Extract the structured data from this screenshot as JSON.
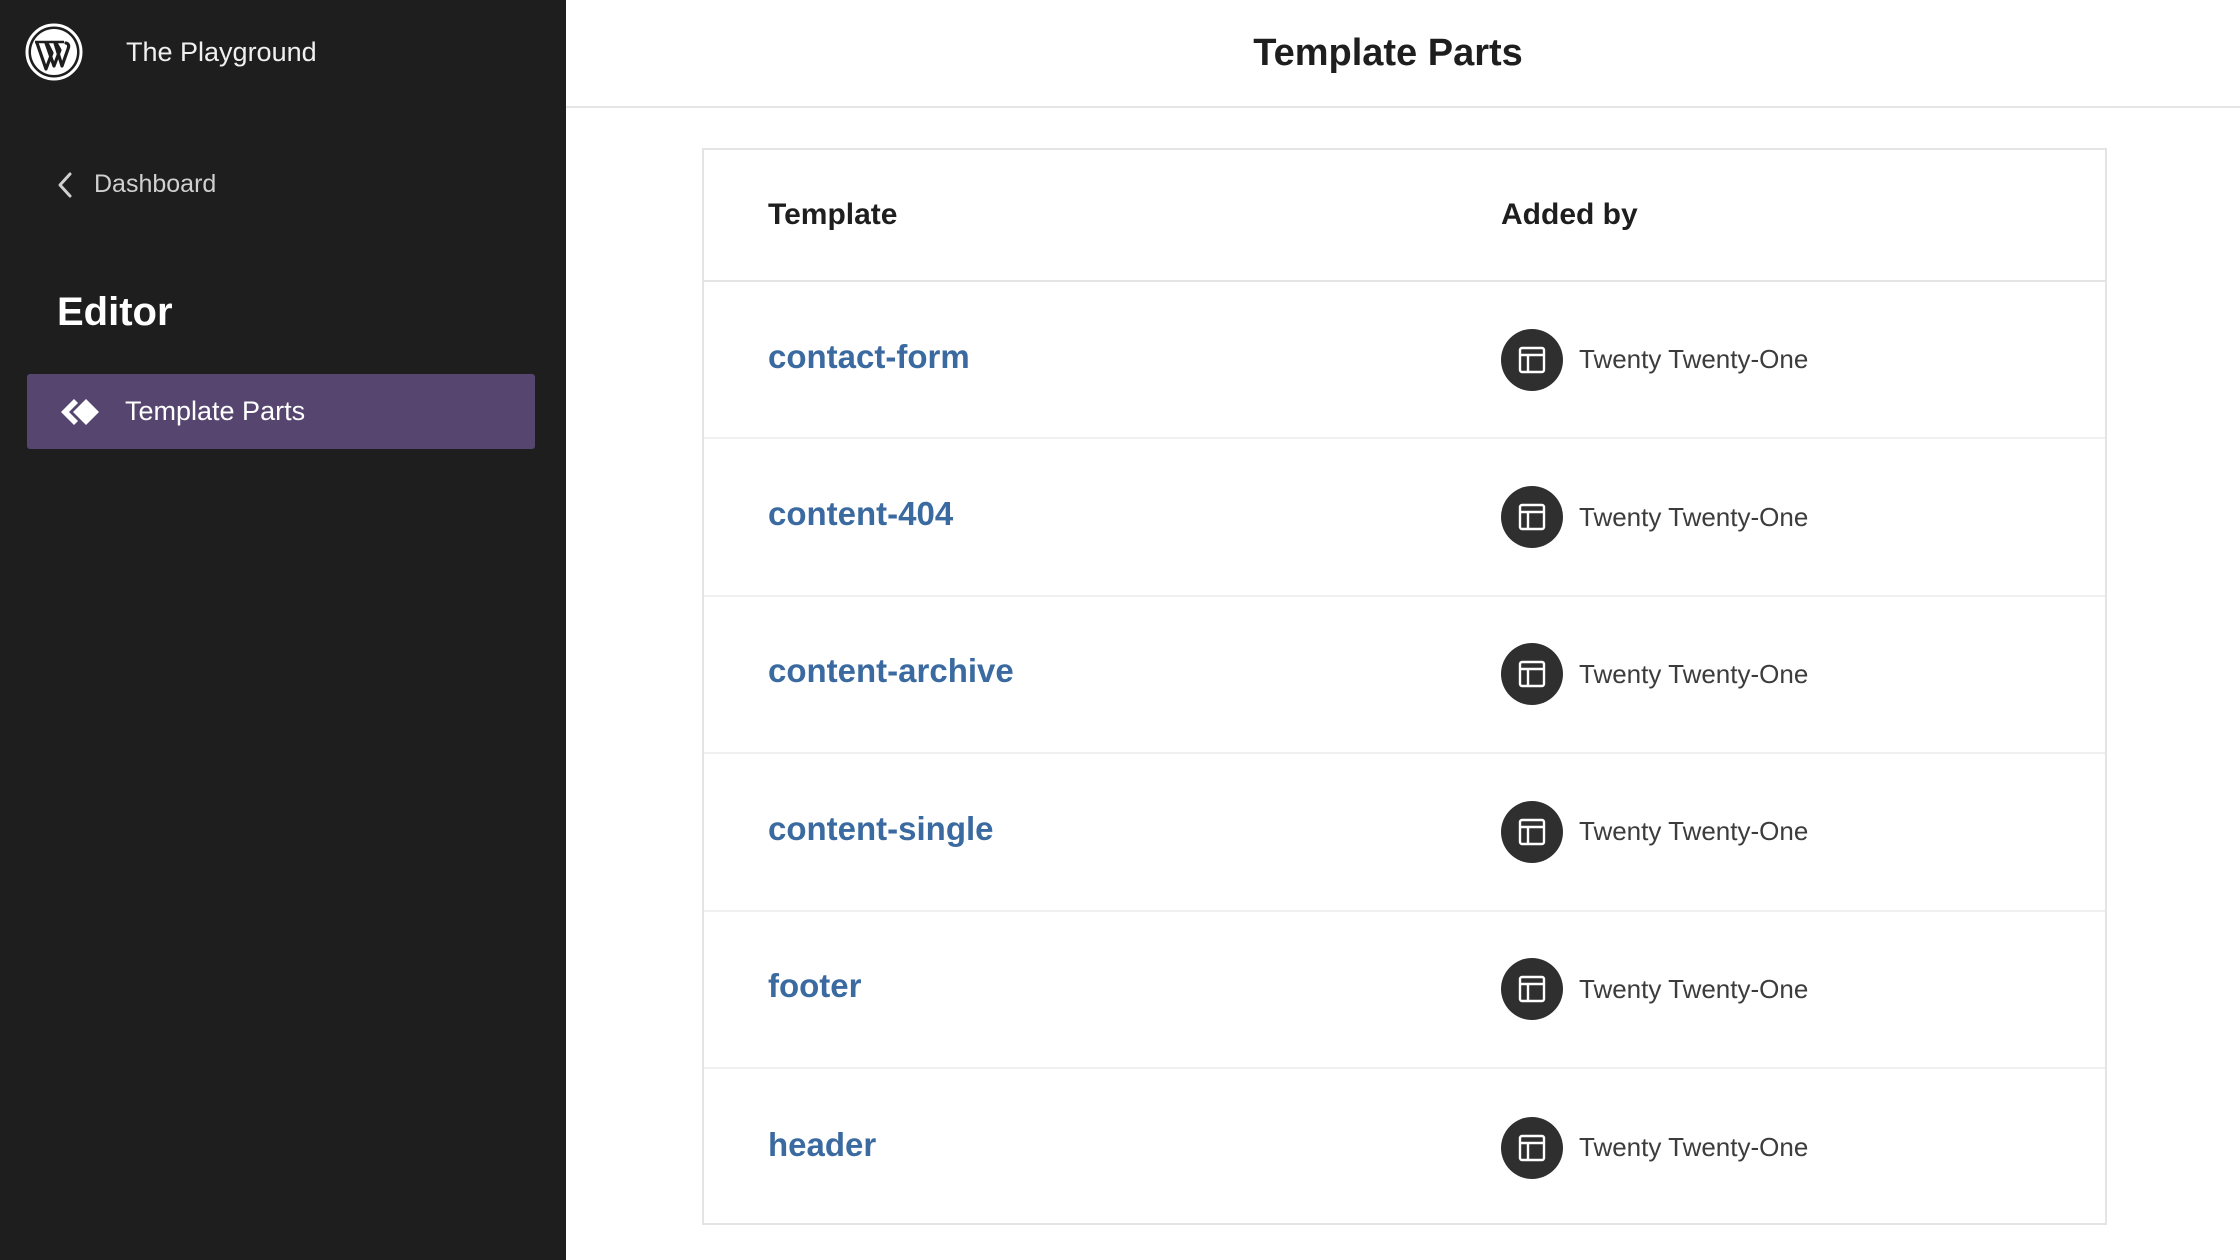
{
  "site": {
    "title": "The Playground",
    "logo_icon": "wordpress-logo-icon"
  },
  "sidebar": {
    "back_label": "Dashboard",
    "heading": "Editor",
    "nav_items": [
      {
        "label": "Template Parts",
        "icon": "symbol-filled-icon",
        "active": true
      }
    ],
    "background": "#1e1e1e",
    "active_color": "#55456f"
  },
  "page": {
    "title": "Template Parts"
  },
  "table": {
    "columns": [
      "Template",
      "Added by"
    ],
    "rows": [
      {
        "name": "contact-form",
        "added_by": "Twenty Twenty-One"
      },
      {
        "name": "content-404",
        "added_by": "Twenty Twenty-One"
      },
      {
        "name": "content-archive",
        "added_by": "Twenty Twenty-One"
      },
      {
        "name": "content-single",
        "added_by": "Twenty Twenty-One"
      },
      {
        "name": "footer",
        "added_by": "Twenty Twenty-One"
      },
      {
        "name": "header",
        "added_by": "Twenty Twenty-One"
      }
    ],
    "link_color": "#3b6aa0"
  }
}
